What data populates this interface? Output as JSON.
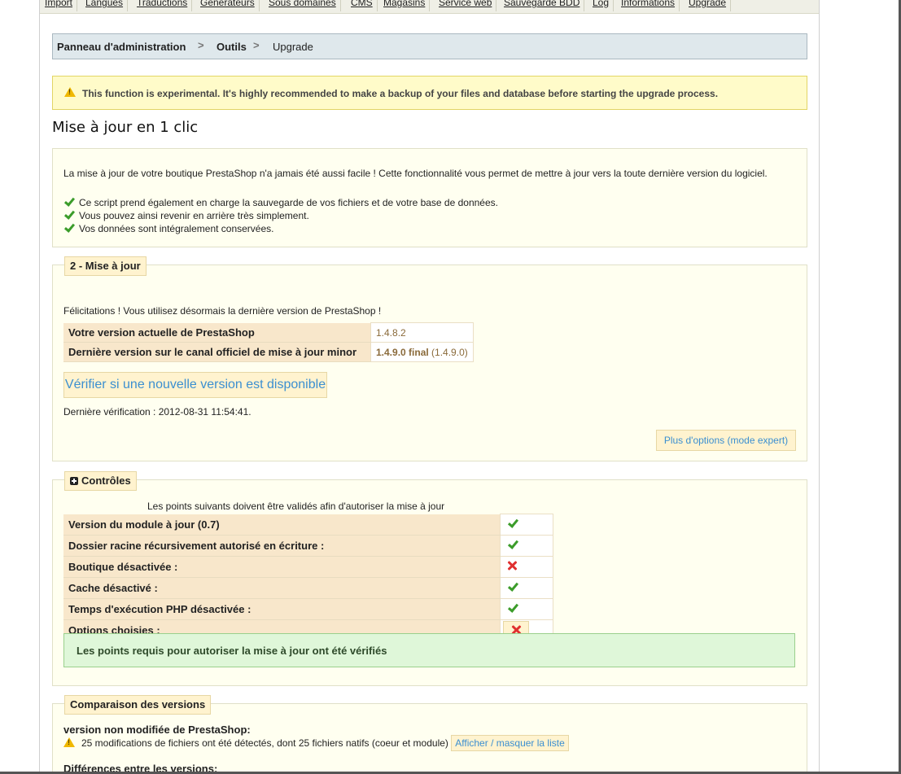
{
  "topnav": {
    "tabs": [
      "Import",
      "Langues",
      "Traductions",
      "Générateurs",
      "Sous domaines",
      "CMS",
      "Magasins",
      "Service web",
      "Sauvegarde BDD",
      "Log",
      "Informations",
      "Upgrade"
    ]
  },
  "breadcrumb": {
    "items": [
      "Panneau d'administration",
      "Outils",
      "Upgrade"
    ],
    "separator": ">"
  },
  "warning": {
    "text": "This function is experimental. It's highly recommended to make a backup of your files and database before starting the upgrade process.",
    "icon": "warning-icon"
  },
  "page_title": "Mise à jour en 1 clic",
  "intro": {
    "paragraph": "La mise à jour de votre boutique PrestaShop n'a jamais été aussi facile ! Cette fonctionnalité vous permet de mettre à jour vers la toute dernière version du logiciel.",
    "features": [
      "Ce script prend également en charge la sauvegarde de vos fichiers et de votre base de données.",
      "Vous pouvez ainsi revenir en arrière très simplement.",
      "Vos données sont intégralement conservées."
    ]
  },
  "upgrade_section": {
    "legend": "2 - Mise à jour",
    "message": "Félicitations ! Vous utilisez désormais la dernière version de PrestaShop !",
    "rows": [
      {
        "label": "Votre version actuelle de PrestaShop",
        "value": "1.4.8.2"
      },
      {
        "label": "Dernière version sur le canal officiel de mise à jour minor",
        "value_bold": "1.4.9.0 final",
        "value_extra": "(1.4.9.0)"
      }
    ],
    "check_button": "Vérifier si une nouvelle version est disponible",
    "last_check": "Dernière vérification : 2012-08-31 11:54:41.",
    "expert_button": "Plus d'options (mode expert)"
  },
  "controls_section": {
    "legend": "Contrôles",
    "intro": "Les points suivants doivent être validés afin d'autoriser la mise à jour",
    "rows": [
      {
        "label": "Version du module à jour (0.7)",
        "status": "ok"
      },
      {
        "label": "Dossier racine récursivement autorisé en écriture :",
        "status": "ok"
      },
      {
        "label": "Boutique désactivée :",
        "status": "ko"
      },
      {
        "label": "Cache désactivé :",
        "status": "ok"
      },
      {
        "label": "Temps d'exécution PHP désactivée :",
        "status": "ok"
      },
      {
        "label": "Options choisies :",
        "status": "ko-button"
      }
    ],
    "success": "Les points requis pour autoriser la mise à jour ont été vérifiés"
  },
  "compare_section": {
    "legend": "Comparaison des versions",
    "subtitle": "version non modifiée de PrestaShop:",
    "changes": "25 modifications de fichiers ont été détectés, dont 25 fichiers natifs (coeur et module)",
    "toggle_button": "Afficher / masquer la liste",
    "diff_title": "Différences entre les versions:"
  },
  "colors": {
    "accent_link": "#3b8fd0",
    "ok": "#3b9c2a",
    "ko": "#e03030",
    "panel": "#fffff0",
    "legend_bg": "#fff3cf"
  }
}
